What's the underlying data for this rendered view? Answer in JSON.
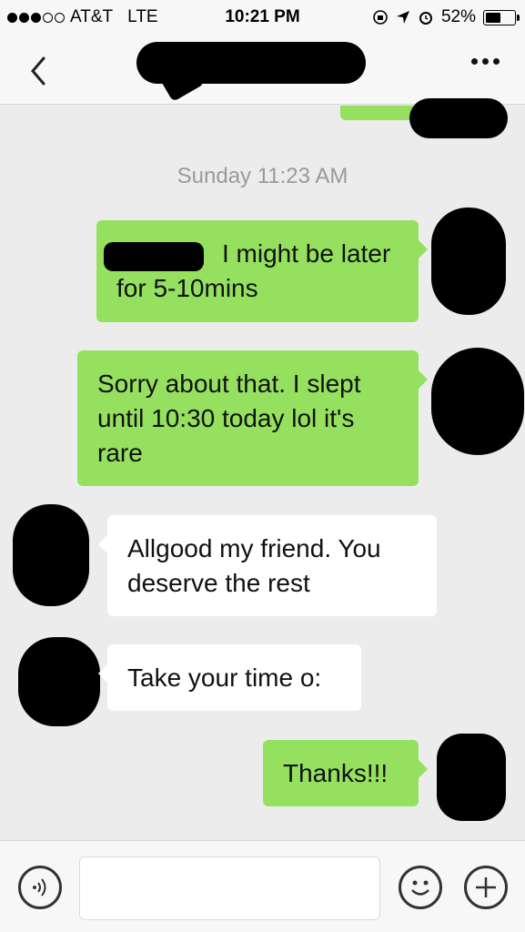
{
  "status_bar": {
    "carrier": "AT&T",
    "network": "LTE",
    "time": "10:21 PM",
    "battery": "52%",
    "battery_level": 0.52
  },
  "nav": {
    "back_icon": "chevron-left-icon",
    "more_icon": "ellipsis-icon"
  },
  "chat": {
    "timestamp": "Sunday 11:23 AM",
    "messages": [
      {
        "side": "out",
        "lines": [
          "I might be later",
          "for 5-10mins"
        ]
      },
      {
        "side": "out",
        "lines": [
          "Sorry about that. I slept",
          "until 10:30 today lol it's",
          "rare"
        ]
      },
      {
        "side": "in",
        "lines": [
          "Allgood my friend. You",
          "deserve the rest"
        ]
      },
      {
        "side": "in",
        "lines": [
          "Take your time o:"
        ]
      },
      {
        "side": "out",
        "lines": [
          "Thanks!!!"
        ]
      }
    ]
  },
  "input_bar": {
    "voice_icon": "voice-icon",
    "emoji_icon": "emoji-icon",
    "plus_icon": "plus-icon"
  },
  "colors": {
    "outgoing_bubble": "#95e15f",
    "incoming_bubble": "#ffffff",
    "background": "#ececec"
  }
}
